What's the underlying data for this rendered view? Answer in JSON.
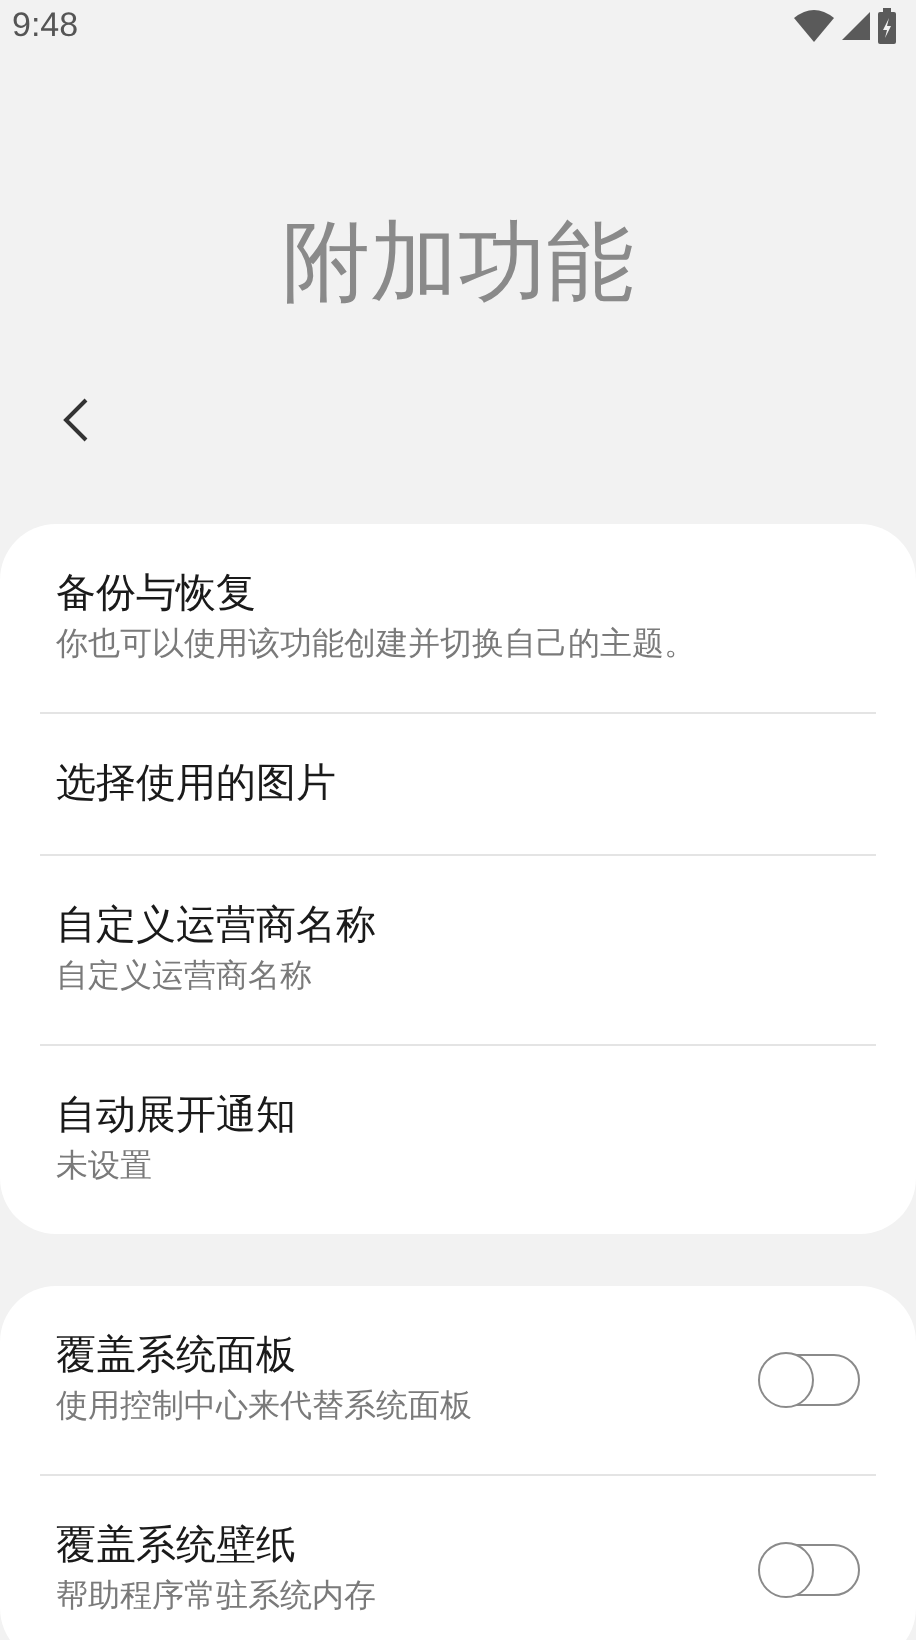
{
  "status_bar": {
    "time": "9:48"
  },
  "title": "附加功能",
  "groups": [
    {
      "items": [
        {
          "kind": "nav",
          "title": "备份与恢复",
          "subtitle": "你也可以使用该功能创建并切换自己的主题。"
        },
        {
          "kind": "nav",
          "title": "选择使用的图片"
        },
        {
          "kind": "nav",
          "title": "自定义运营商名称",
          "subtitle": "自定义运营商名称"
        },
        {
          "kind": "nav",
          "title": "自动展开通知",
          "subtitle": "未设置"
        }
      ]
    },
    {
      "items": [
        {
          "kind": "toggle",
          "title": "覆盖系统面板",
          "subtitle": "使用控制中心来代替系统面板",
          "on": false
        },
        {
          "kind": "toggle",
          "title": "覆盖系统壁纸",
          "subtitle": "帮助程序常驻系统内存",
          "on": false
        }
      ]
    }
  ]
}
